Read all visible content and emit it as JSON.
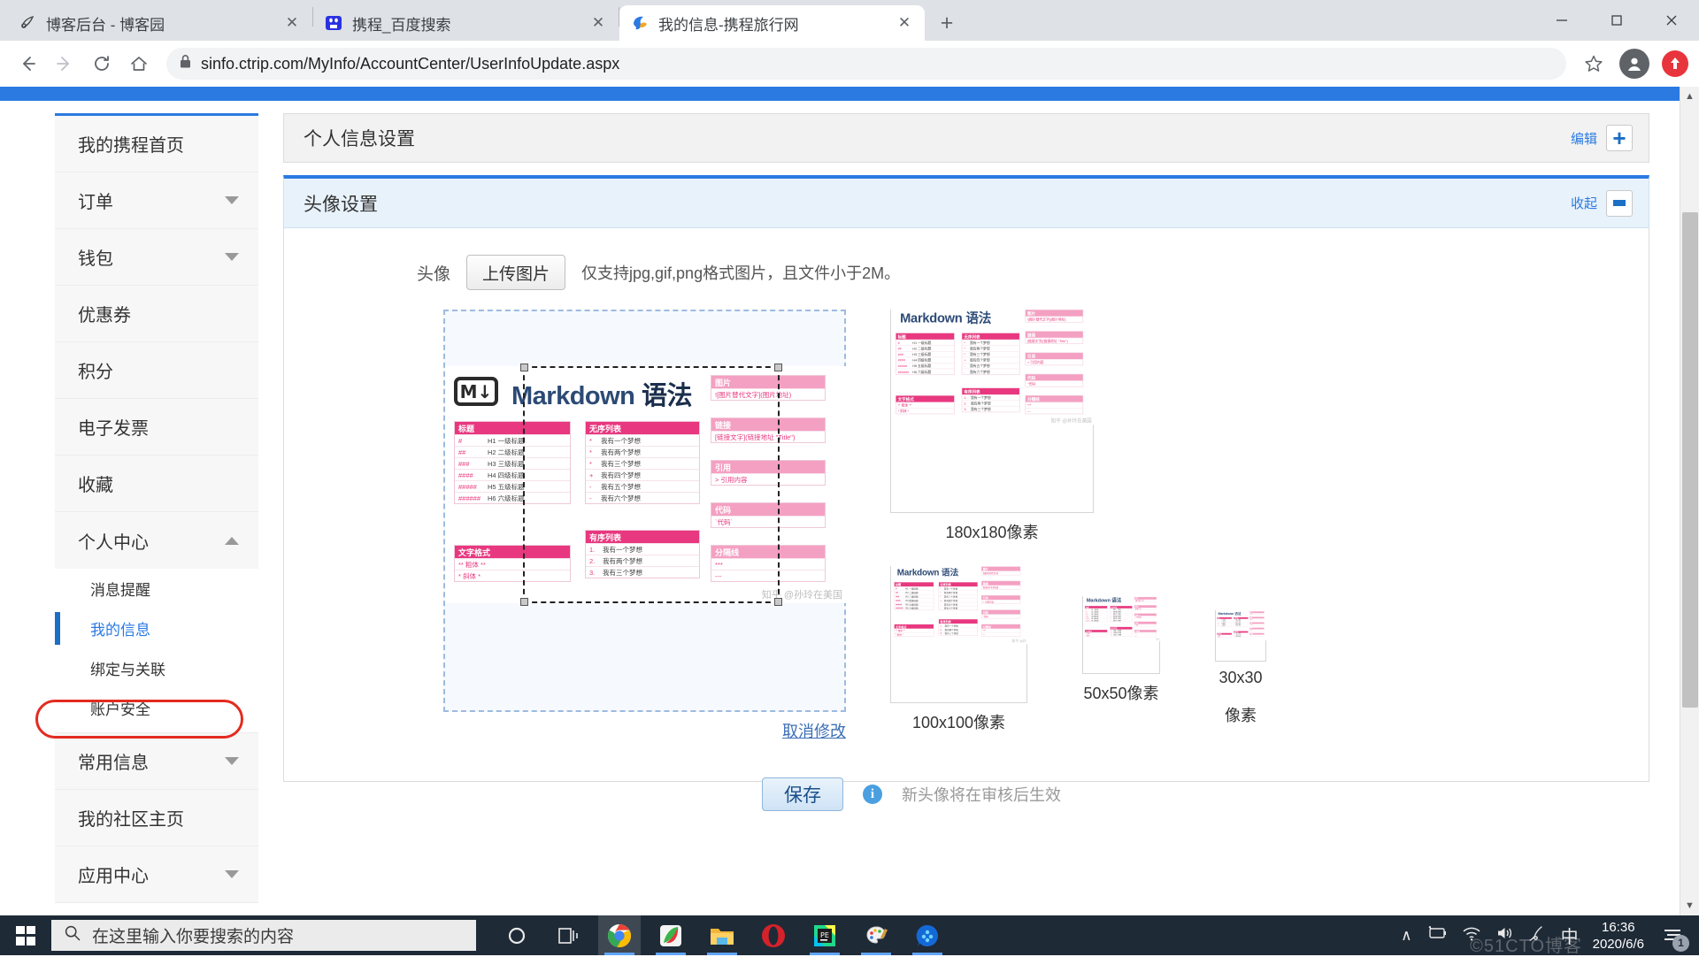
{
  "browser": {
    "tabs": [
      {
        "title": "博客后台 - 博客园",
        "favicon": "blog-icon",
        "active": false
      },
      {
        "title": "携程_百度搜索",
        "favicon": "baidu-icon",
        "active": false
      },
      {
        "title": "我的信息-携程旅行网",
        "favicon": "ctrip-icon",
        "active": true
      }
    ],
    "new_tab_label": "+",
    "close_label": "✕",
    "window_controls": {
      "minimize": "—",
      "maximize": "▢",
      "close": "✕"
    },
    "url": "sinfo.ctrip.com/MyInfo/AccountCenter/UserInfoUpdate.aspx",
    "lock_label": "🔒",
    "back_label": "←",
    "forward_label": "→",
    "reload_label": "⟳",
    "home_label": "⌂",
    "bookmark_label": "☆",
    "profile_label": "●",
    "extension_label": "▲"
  },
  "sidebar": {
    "items": [
      {
        "label": "我的携程首页",
        "type": "link"
      },
      {
        "label": "订单",
        "type": "collapsed"
      },
      {
        "label": "钱包",
        "type": "collapsed"
      },
      {
        "label": "优惠券",
        "type": "link"
      },
      {
        "label": "积分",
        "type": "link"
      },
      {
        "label": "电子发票",
        "type": "link"
      },
      {
        "label": "收藏",
        "type": "link"
      },
      {
        "label": "个人中心",
        "type": "expanded"
      }
    ],
    "sub_items": [
      {
        "label": "消息提醒",
        "active": false
      },
      {
        "label": "我的信息",
        "active": true
      },
      {
        "label": "绑定与关联",
        "active": false
      },
      {
        "label": "账户安全",
        "active": false
      }
    ],
    "items_after": [
      {
        "label": "常用信息",
        "type": "collapsed"
      },
      {
        "label": "我的社区主页",
        "type": "link"
      },
      {
        "label": "应用中心",
        "type": "collapsed"
      }
    ]
  },
  "main": {
    "panel_title": "个人信息设置",
    "panel_action": "编辑",
    "section_title": "头像设置",
    "section_action": "收起",
    "avatar_label": "头像",
    "upload_button": "上传图片",
    "upload_hint": "仅支持jpg,gif,png格式图片，且文件小于2M。",
    "cancel_link": "取消修改",
    "save_button": "保存",
    "save_note": "新头像将在审核后生效",
    "previews": [
      {
        "caption": "180x180像素",
        "size": "180"
      },
      {
        "caption": "100x100像素",
        "size": "100"
      },
      {
        "caption": "50x50像素",
        "size": "50"
      },
      {
        "caption": "30x30\n像素",
        "size": "30"
      }
    ],
    "preview_caption_180": "180x180像素",
    "preview_caption_100": "100x100像素",
    "preview_caption_50": "50x50像素",
    "preview_caption_30a": "30x30",
    "preview_caption_30b": "像素"
  },
  "artwork": {
    "title_en": "Markdown",
    "title_cn": "语法",
    "logo": "M↓",
    "watermark": "知乎 @孙玲在美国",
    "cards": {
      "heading": {
        "title": "标题",
        "rows": [
          {
            "k": "#",
            "v": "H1 一级标题"
          },
          {
            "k": "##",
            "v": "H2 二级标题"
          },
          {
            "k": "###",
            "v": "H3 三级标题"
          },
          {
            "k": "####",
            "v": "H4 四级标题"
          },
          {
            "k": "#####",
            "v": "H5 五级标题"
          },
          {
            "k": "######",
            "v": "H6 六级标题"
          }
        ]
      },
      "textformat": {
        "title": "文字格式",
        "rows": [
          {
            "k": "** 粗体 **",
            "v": ""
          },
          {
            "k": "* 斜体 *",
            "v": ""
          }
        ]
      },
      "ul": {
        "title": "无序列表",
        "rows": [
          {
            "k": "*",
            "v": "我有一个梦想"
          },
          {
            "k": "*",
            "v": "我有两个梦想"
          },
          {
            "k": "*",
            "v": "我有三个梦想"
          },
          {
            "k": "+",
            "v": "我有四个梦想"
          },
          {
            "k": "-",
            "v": "我有五个梦想"
          },
          {
            "k": "-",
            "v": "我有六个梦想"
          }
        ]
      },
      "ol": {
        "title": "有序列表",
        "rows": [
          {
            "k": "1.",
            "v": "我有一个梦想"
          },
          {
            "k": "2.",
            "v": "我有两个梦想"
          },
          {
            "k": "3.",
            "v": "我有三个梦想"
          }
        ]
      },
      "image": {
        "title": "图片",
        "rows": [
          {
            "k": "![图片替代文字](图片地址)",
            "v": ""
          }
        ]
      },
      "link": {
        "title": "链接",
        "rows": [
          {
            "k": "[链接文字](链接地址 \"Title\")",
            "v": ""
          }
        ]
      },
      "quote": {
        "title": "引用",
        "rows": [
          {
            "k": "> 引用内容",
            "v": ""
          }
        ]
      },
      "code": {
        "title": "代码",
        "rows": [
          {
            "k": "`代码`",
            "v": ""
          }
        ]
      },
      "hr": {
        "title": "分隔线",
        "rows": [
          {
            "k": "***",
            "v": ""
          },
          {
            "k": "---",
            "v": ""
          }
        ]
      }
    }
  },
  "taskbar": {
    "search_placeholder": "在这里输入你要搜索的内容",
    "search_icon": "search-icon",
    "cortana_icon": "cortana-icon",
    "taskview_icon": "task-view-icon",
    "apps": [
      "chrome",
      "xmind",
      "file-explorer",
      "opera",
      "pycharm",
      "paint",
      "potplayer"
    ],
    "tray": {
      "chevron": "∧",
      "battery": "battery-icon",
      "wifi": "wifi-icon",
      "volume": "volume-icon",
      "pen": "pen-icon",
      "ime": "中"
    },
    "time": "16:36",
    "date": "2020/6/6",
    "notification_count": "1"
  },
  "watermark": "©51CTO博客"
}
